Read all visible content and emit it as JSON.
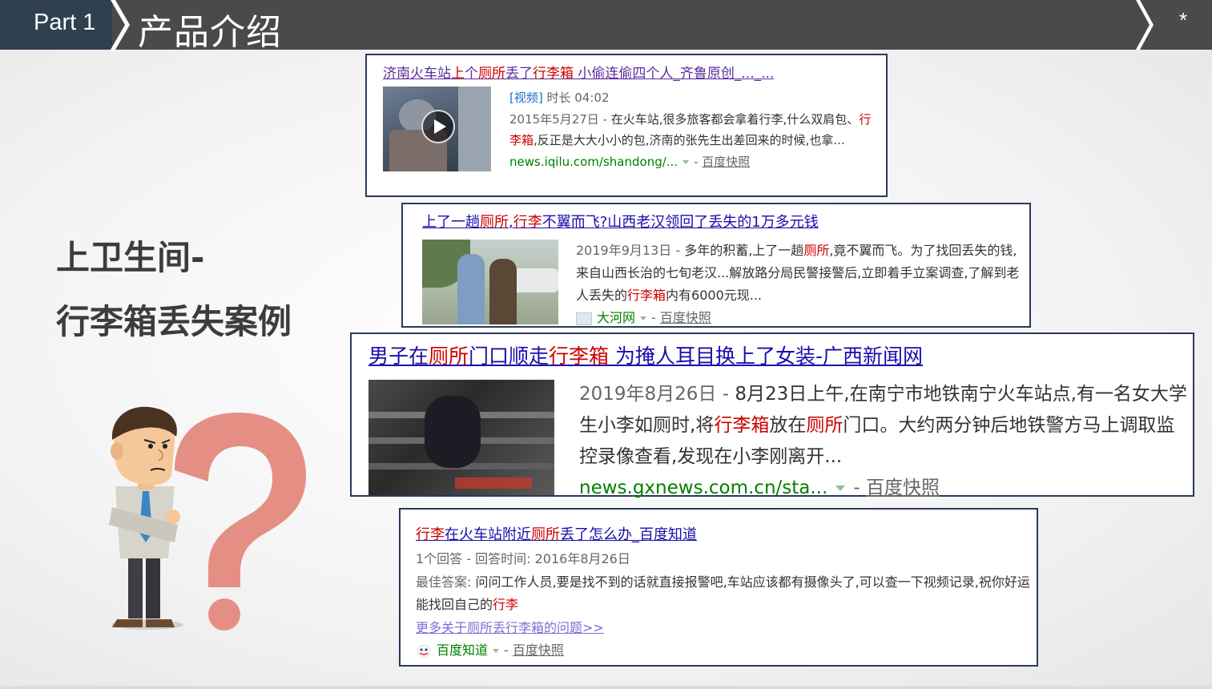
{
  "header": {
    "part_label": "Part  1",
    "title": "产品介绍",
    "corner_mark": "*"
  },
  "side": {
    "line1": "上卫生间-",
    "line2": "行李箱丢失案例"
  },
  "results": [
    {
      "title_segments": [
        {
          "text": "济南火车站",
          "hl": false
        },
        {
          "text": "上",
          "hl": true
        },
        {
          "text": "个",
          "hl": false
        },
        {
          "text": "厕所",
          "hl": true
        },
        {
          "text": "丢了",
          "hl": false
        },
        {
          "text": "行李箱",
          "hl": true
        },
        {
          "text": " 小偷连偷四个人_齐鲁原创_..._...",
          "hl": false
        }
      ],
      "tag": "[视频]",
      "duration": "时长 04:02",
      "body_segments": [
        {
          "text": "2015年5月27日 - ",
          "gray": true
        },
        {
          "text": "在火车站,很多旅客都会拿着行李,什么双肩包、"
        },
        {
          "text": "行李箱",
          "hl": true
        },
        {
          "text": ",反正是大大小小的包,济南的张先生出差回来的时候,也拿..."
        }
      ],
      "url": "news.iqilu.com/shandong/...",
      "snapshot": "百度快照"
    },
    {
      "title_segments": [
        {
          "text": "上了一趟",
          "hl": false
        },
        {
          "text": "厕所",
          "hl": true
        },
        {
          "text": ",",
          "hl": false
        },
        {
          "text": "行李",
          "hl": true
        },
        {
          "text": "不翼而飞?山西老汉领回了丢失的1万多元钱",
          "hl": false
        }
      ],
      "body_segments": [
        {
          "text": "2019年9月13日 - ",
          "gray": true
        },
        {
          "text": "多年的积蓄,上了一趟"
        },
        {
          "text": "厕所",
          "hl": true
        },
        {
          "text": ",竟不翼而飞。为了找回丢失的钱,来自山西长治的七旬老汉...解放路分局民警接警后,立即着手立案调查,了解到老人丢失的"
        },
        {
          "text": "行李箱",
          "hl": true
        },
        {
          "text": "内有6000元现..."
        }
      ],
      "source": "大河网",
      "snapshot": "百度快照"
    },
    {
      "title_segments": [
        {
          "text": "男子在",
          "hl": false
        },
        {
          "text": "厕所",
          "hl": true
        },
        {
          "text": "门口顺走",
          "hl": false
        },
        {
          "text": "行李箱",
          "hl": true
        },
        {
          "text": " 为掩人耳目换上了女装-广西新闻网",
          "hl": false
        }
      ],
      "body_segments": [
        {
          "text": "2019年8月26日 - ",
          "gray": true
        },
        {
          "text": "8月23日上午,在南宁市地铁南宁火车站点,有一名女大学生小李如厕时,将"
        },
        {
          "text": "行李箱",
          "hl": true
        },
        {
          "text": "放在"
        },
        {
          "text": "厕所",
          "hl": true
        },
        {
          "text": "门口。大约两分钟后地铁警方马上调取监控录像查看,发现在小李刚离开..."
        }
      ],
      "url": "news.gxnews.com.cn/sta...",
      "snapshot": "百度快照"
    },
    {
      "title_segments": [
        {
          "text": "行李",
          "hl": true
        },
        {
          "text": "在火车站附近",
          "hl": false
        },
        {
          "text": "厕所",
          "hl": true
        },
        {
          "text": "丢了怎么办_百度知道",
          "hl": false
        }
      ],
      "meta": "1个回答 - 回答时间: 2016年8月26日",
      "body_segments": [
        {
          "text": "最佳答案: ",
          "gray": true
        },
        {
          "text": "问问工作人员,要是找不到的话就直接报警吧,车站应该都有摄像头了,可以查一下视频记录,祝你好运能找回自己的"
        },
        {
          "text": "行李",
          "hl": true
        }
      ],
      "more_link": "更多关于厕所丢行李箱的问题>>",
      "source": "百度知道",
      "snapshot": "百度快照"
    }
  ],
  "colors": {
    "topbar": "#4a4a4a",
    "part_tab": "#2f4050",
    "link_blue": "#1a0dab",
    "highlight_red": "#cc0000",
    "url_green": "#008000",
    "card_border": "#283a5c",
    "question_mark": "#e58f84"
  }
}
